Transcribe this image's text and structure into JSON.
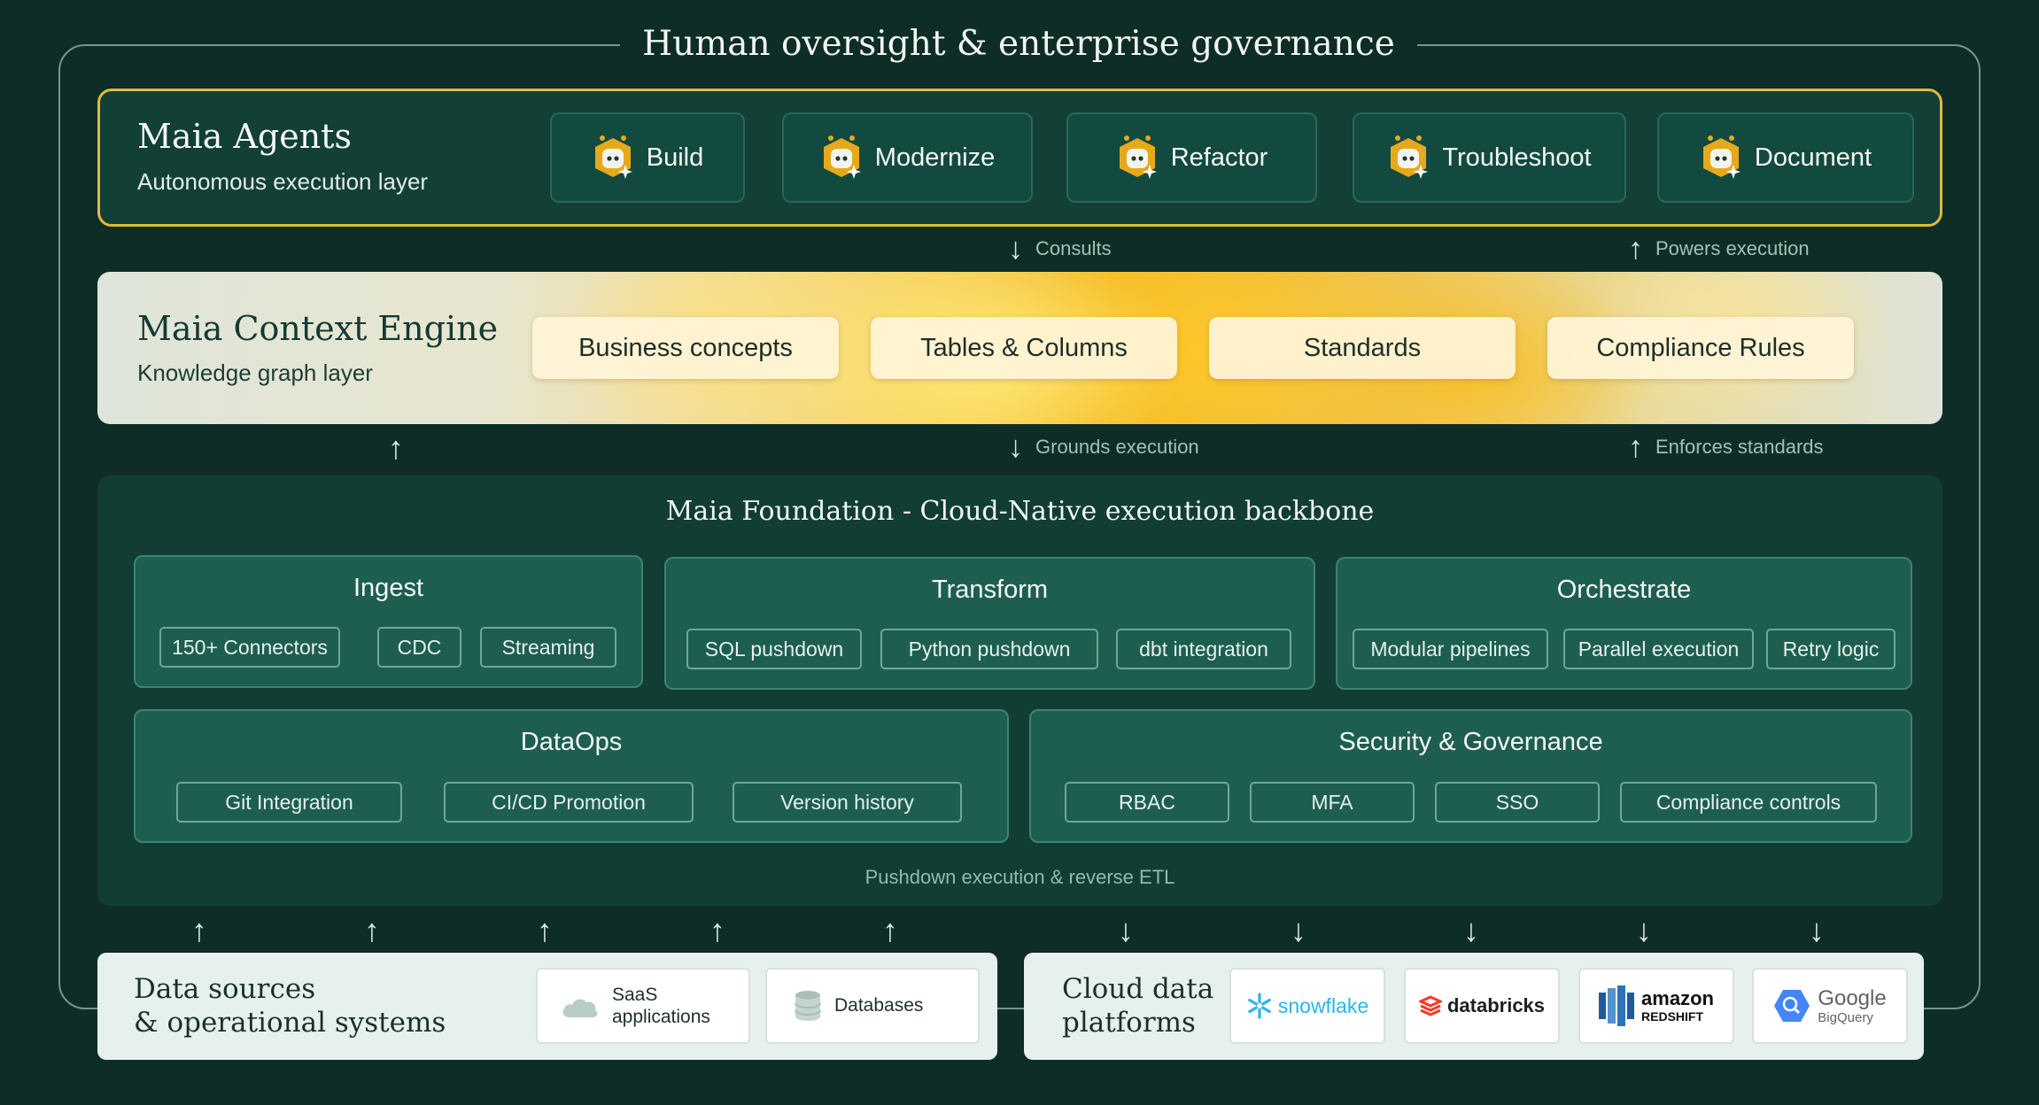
{
  "governance": {
    "title": "Human oversight & enterprise governance"
  },
  "agents": {
    "title": "Maia Agents",
    "subtitle": "Autonomous execution layer",
    "items": [
      {
        "label": "Build"
      },
      {
        "label": "Modernize"
      },
      {
        "label": "Refactor"
      },
      {
        "label": "Troubleshoot"
      },
      {
        "label": "Document"
      }
    ]
  },
  "flows": {
    "consults": "Consults",
    "powers_execution": "Powers execution",
    "grounds_execution": "Grounds execution",
    "enforces_standards": "Enforces standards",
    "pushdown": "Pushdown execution & reverse ETL"
  },
  "context_engine": {
    "title": "Maia Context Engine",
    "subtitle": "Knowledge graph layer",
    "items": [
      "Business concepts",
      "Tables & Columns",
      "Standards",
      "Compliance Rules"
    ]
  },
  "foundation": {
    "title": "Maia Foundation -  Cloud-Native execution backbone",
    "modules": {
      "ingest": {
        "title": "Ingest",
        "items": [
          "150+ Connectors",
          "CDC",
          "Streaming"
        ]
      },
      "transform": {
        "title": "Transform",
        "items": [
          "SQL pushdown",
          "Python pushdown",
          "dbt integration"
        ]
      },
      "orchestrate": {
        "title": "Orchestrate",
        "items": [
          "Modular pipelines",
          "Parallel execution",
          "Retry logic"
        ]
      },
      "dataops": {
        "title": "DataOps",
        "items": [
          "Git Integration",
          "CI/CD Promotion",
          "Version history"
        ]
      },
      "security": {
        "title": "Security & Governance",
        "items": [
          "RBAC",
          "MFA",
          "SSO",
          "Compliance controls"
        ]
      }
    }
  },
  "sources": {
    "title_line1": "Data sources",
    "title_line2": "& operational systems",
    "saas_line1": "SaaS",
    "saas_line2": "applications",
    "databases": "Databases"
  },
  "platforms": {
    "title_line1": "Cloud data",
    "title_line2": "platforms",
    "snowflake": "snowflake",
    "databricks": "databricks",
    "amazon": "amazon",
    "redshift": "REDSHIFT",
    "google": "Google",
    "bigquery": "BigQuery"
  },
  "colors": {
    "background": "#0f2d27",
    "accent_gold": "#e2b93b",
    "module_green": "#1d5e51",
    "snowflake_blue": "#29b5e8",
    "databricks_red": "#ff3621",
    "redshift_blue": "#205b97",
    "bigquery_blue": "#4386fa"
  },
  "icons": {
    "agent": "maia-agent-icon",
    "saas": "cloud-icon",
    "databases": "database-icon"
  }
}
